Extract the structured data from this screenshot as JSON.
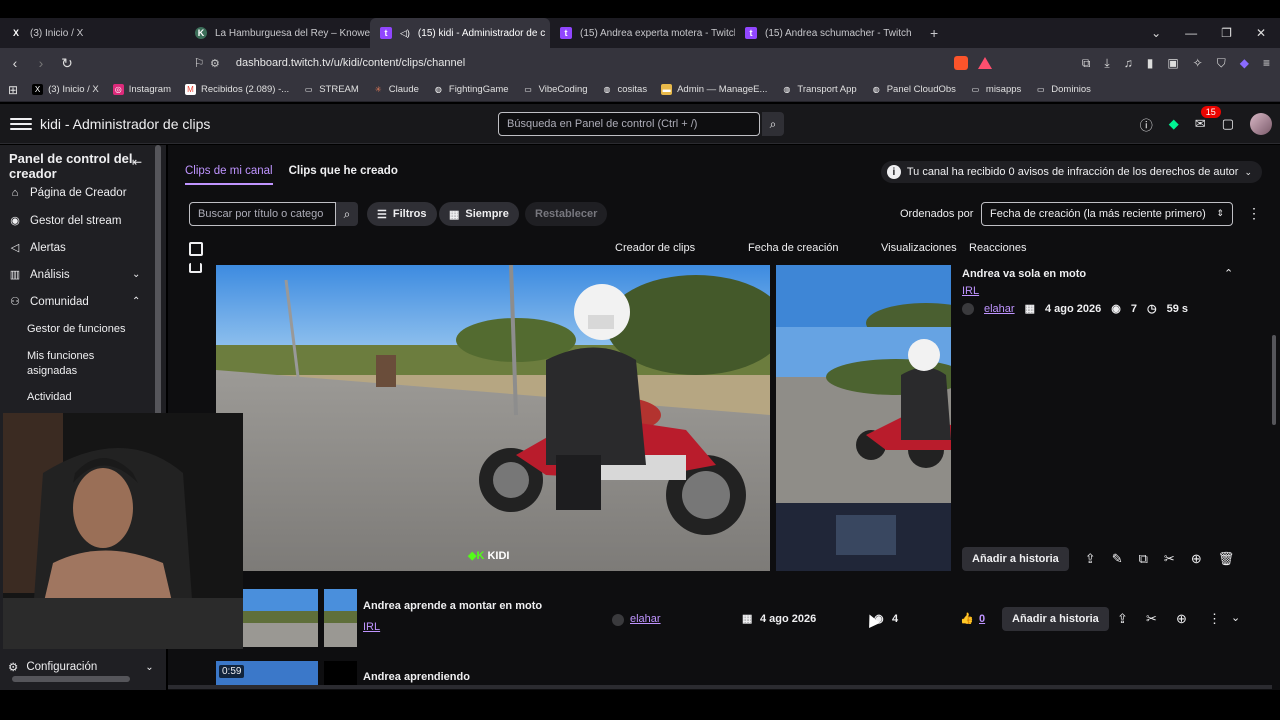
{
  "browser": {
    "tabs": [
      {
        "label": "(3) Inicio / X",
        "fav": "X",
        "favColor": "#000000"
      },
      {
        "label": "La Hamburguesa del Rey – Knoweats",
        "fav": "K",
        "favColor": "#3c6e59"
      },
      {
        "label": "(15) kidi - Administrador de c",
        "fav": "t",
        "favColor": "#9146ff",
        "active": true
      },
      {
        "label": "(15) Andrea experta motera - Twitch",
        "fav": "t",
        "favColor": "#9146ff"
      },
      {
        "label": "(15) Andrea schumacher - Twitch",
        "fav": "t",
        "favColor": "#9146ff"
      }
    ],
    "url": "dashboard.twitch.tv/u/kidi/content/clips/channel",
    "bookmarks": [
      {
        "label": "(3) Inicio / X",
        "color": "#000000",
        "ic": "X"
      },
      {
        "label": "Instagram",
        "color": "#dd2a7b",
        "ic": "◎"
      },
      {
        "label": "Recibidos (2.089) -...",
        "color": "#ea4335",
        "ic": "M"
      },
      {
        "label": "STREAM",
        "color": "transparent",
        "ic": "▭"
      },
      {
        "label": "Claude",
        "color": "#d97757",
        "ic": "✳"
      },
      {
        "label": "FightingGame",
        "color": "transparent",
        "ic": "◍"
      },
      {
        "label": "VibeCoding",
        "color": "transparent",
        "ic": "▭"
      },
      {
        "label": "cositas",
        "color": "transparent",
        "ic": "◍"
      },
      {
        "label": "Admin — ManageE...",
        "color": "#e8b94a",
        "ic": "▬"
      },
      {
        "label": "Transport App",
        "color": "transparent",
        "ic": "◍"
      },
      {
        "label": "Panel CloudObs",
        "color": "transparent",
        "ic": "◍"
      },
      {
        "label": "misapps",
        "color": "transparent",
        "ic": "▭"
      },
      {
        "label": "Dominios",
        "color": "transparent",
        "ic": "▭"
      }
    ]
  },
  "twitch": {
    "title": "kidi - Administrador de clips",
    "search_placeholder": "Búsqueda en Panel de control (Ctrl + /)",
    "notif_count": "15"
  },
  "sidebar": {
    "heading": "Panel de control del creador",
    "items": [
      {
        "label": "Página de Creador",
        "icon": "⌂"
      },
      {
        "label": "Gestor del stream",
        "icon": "((·))"
      },
      {
        "label": "Alertas",
        "icon": "◁)"
      },
      {
        "label": "Análisis",
        "icon": "▥",
        "chev": "⌄"
      },
      {
        "label": "Comunidad",
        "icon": "⚇",
        "chev": "⌃"
      }
    ],
    "subitems": [
      "Gestor de funciones",
      "Mis funciones asignadas",
      "Actividad"
    ],
    "config": "Configuración"
  },
  "main": {
    "tabs": [
      "Clips de mi canal",
      "Clips que he creado"
    ],
    "copyright": "Tu canal ha recibido 0 avisos de infracción de los derechos de autor",
    "search_placeholder": "Buscar por título o catego",
    "filters": "Filtros",
    "range": "Siempre",
    "reset": "Restablecer",
    "sort_label": "Ordenados por",
    "sort_value": "Fecha de creación (la más reciente primero)",
    "columns": [
      "Creador de clips",
      "Fecha de creación",
      "Visualizaciones",
      "Reacciones"
    ]
  },
  "clips": [
    {
      "title": "Andrea va sola en moto",
      "category": "IRL",
      "creator": "elahar",
      "date": "4 ago 2026",
      "views": "7",
      "duration": "59 s",
      "story": "Añadir a historia"
    },
    {
      "title": "Andrea aprende a montar en moto",
      "category": "IRL",
      "creator": "elahar",
      "date": "4 ago 2026",
      "views": "4",
      "likes": "0",
      "story": "Añadir a historia"
    },
    {
      "title": "Andrea aprendiendo",
      "duration": "0:59"
    }
  ],
  "watermark": "KIDI"
}
